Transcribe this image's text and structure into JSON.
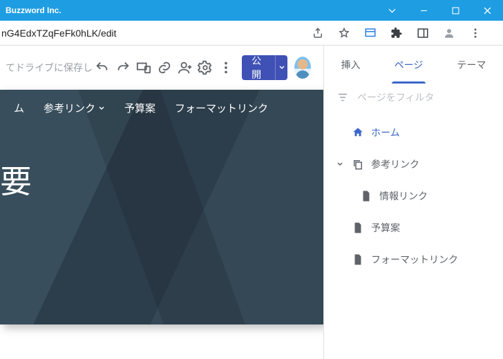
{
  "window": {
    "title": "Buzzword Inc."
  },
  "browser": {
    "url_fragment": "nG4EdxTZqFeFk0hLK/edit"
  },
  "toolbar": {
    "saved_text": "てドライブに保存しました",
    "publish_label": "公開"
  },
  "preview": {
    "nav": {
      "home": "ム",
      "links": "参考リンク",
      "budget": "予算案",
      "format": "フォーマットリンク"
    },
    "headline": "要"
  },
  "sidebar": {
    "tabs": {
      "insert": "挿入",
      "pages": "ページ",
      "theme": "テーマ"
    },
    "filter_placeholder": "ページをフィルタ",
    "pages": {
      "home": "ホーム",
      "reference": "参考リンク",
      "reference_child": "情報リンク",
      "budget": "予算案",
      "format": "フォーマットリンク"
    }
  }
}
